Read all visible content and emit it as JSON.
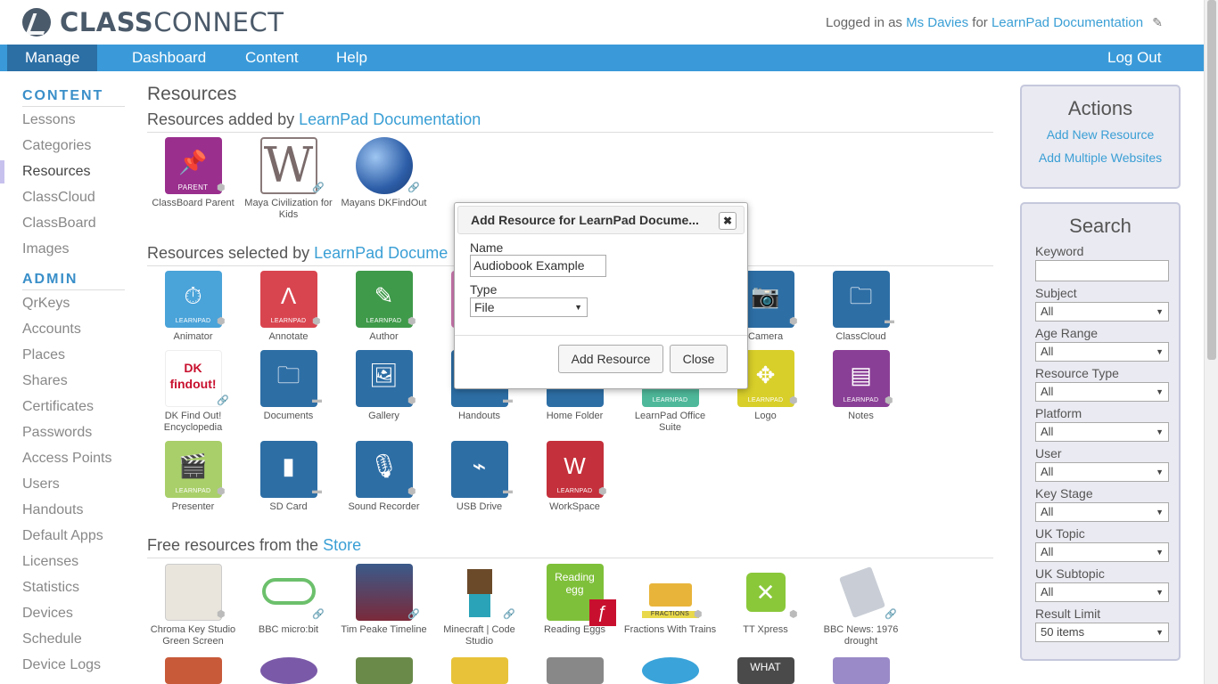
{
  "header": {
    "logo_bold": "CLASS",
    "logo_rest": "CONNECT",
    "logged_in_prefix": "Logged in as",
    "user_name": "Ms Davies",
    "for_text": "for",
    "org_name": "LearnPad Documentation",
    "edit_icon": "pencil-icon"
  },
  "nav": {
    "items": [
      "Manage",
      "Dashboard",
      "Content",
      "Help"
    ],
    "active": "Manage",
    "logout": "Log Out"
  },
  "sidebar": {
    "content_heading": "CONTENT",
    "content_items": [
      "Lessons",
      "Categories",
      "Resources",
      "ClassCloud",
      "ClassBoard",
      "Images"
    ],
    "active_item": "Resources",
    "admin_heading": "ADMIN",
    "admin_items": [
      "QrKeys",
      "Accounts",
      "Places",
      "Shares",
      "Certificates",
      "Passwords",
      "Access Points",
      "Users",
      "Handouts",
      "Default Apps",
      "Licenses",
      "Statistics",
      "Devices",
      "Schedule",
      "Device Logs"
    ]
  },
  "main": {
    "page_title": "Resources",
    "added_by_prefix": "Resources added by",
    "added_by_link": "LearnPad Documentation",
    "added": [
      {
        "label": "ClassBoard Parent",
        "badge": "PARENT"
      },
      {
        "label": "Maya Civilization for Kids",
        "badge": "W"
      },
      {
        "label": "Mayans DKFindOut",
        "badge": ""
      }
    ],
    "selected_by_prefix": "Resources selected by",
    "selected_by_link": "LearnPad Docume",
    "selected_row1": [
      {
        "label": "Animator",
        "badge": "LEARNPAD"
      },
      {
        "label": "Annotate",
        "badge": "LEARNPAD"
      },
      {
        "label": "Author",
        "badge": "LEARNPAD"
      },
      {
        "label": "E",
        "badge": ""
      },
      {
        "label": "",
        "badge": ""
      },
      {
        "label": "",
        "badge": ""
      },
      {
        "label": "Camera",
        "badge": ""
      },
      {
        "label": "ClassCloud",
        "badge": ""
      }
    ],
    "selected_row2": [
      {
        "label": "DK Find Out! Encyclopedia",
        "badge": "DK findout!"
      },
      {
        "label": "Documents",
        "badge": ""
      },
      {
        "label": "Gallery",
        "badge": ""
      },
      {
        "label": "Handouts",
        "badge": ""
      },
      {
        "label": "Home Folder",
        "badge": ""
      },
      {
        "label": "LearnPad Office Suite",
        "badge": "LEARNPAD"
      },
      {
        "label": "Logo",
        "badge": "LEARNPAD"
      },
      {
        "label": "Notes",
        "badge": "LEARNPAD"
      }
    ],
    "selected_row3": [
      {
        "label": "Presenter",
        "badge": "LEARNPAD"
      },
      {
        "label": "SD Card",
        "badge": ""
      },
      {
        "label": "Sound Recorder",
        "badge": ""
      },
      {
        "label": "USB Drive",
        "badge": ""
      },
      {
        "label": "WorkSpace",
        "badge": "LEARNPAD"
      }
    ],
    "store_prefix": "Free resources from the",
    "store_link": "Store",
    "store_row": [
      {
        "label": "Chroma Key Studio Green Screen"
      },
      {
        "label": "BBC micro:bit"
      },
      {
        "label": "Tim Peake Timeline"
      },
      {
        "label": "Minecraft | Code Studio"
      },
      {
        "label": "Reading Eggs",
        "badge": "Reading egg"
      },
      {
        "label": "Fractions With Trains",
        "badge": "FRACTIONS"
      },
      {
        "label": "TT Xpress"
      },
      {
        "label": "BBC News: 1976 drought"
      }
    ],
    "store_row_more": [
      {
        "badge": ""
      },
      {
        "badge": ""
      },
      {
        "badge": ""
      },
      {
        "badge": ""
      },
      {
        "badge": ""
      },
      {
        "badge": ""
      },
      {
        "badge": "WHAT"
      },
      {
        "badge": ""
      }
    ]
  },
  "actions": {
    "title": "Actions",
    "add_new": "Add New Resource",
    "add_multiple": "Add Multiple Websites"
  },
  "search": {
    "title": "Search",
    "keyword_label": "Keyword",
    "keyword_value": "",
    "filters": [
      {
        "label": "Subject",
        "value": "All"
      },
      {
        "label": "Age Range",
        "value": "All"
      },
      {
        "label": "Resource Type",
        "value": "All"
      },
      {
        "label": "Platform",
        "value": "All"
      },
      {
        "label": "User",
        "value": "All"
      },
      {
        "label": "Key Stage",
        "value": "All"
      },
      {
        "label": "UK Topic",
        "value": "All"
      },
      {
        "label": "UK Subtopic",
        "value": "All"
      },
      {
        "label": "Result Limit",
        "value": "50 items"
      }
    ]
  },
  "dialog": {
    "title": "Add Resource for LearnPad Docume...",
    "close_x": "✖",
    "name_label": "Name",
    "name_value": "Audiobook Example",
    "type_label": "Type",
    "type_value": "File",
    "submit": "Add Resource",
    "close": "Close"
  }
}
